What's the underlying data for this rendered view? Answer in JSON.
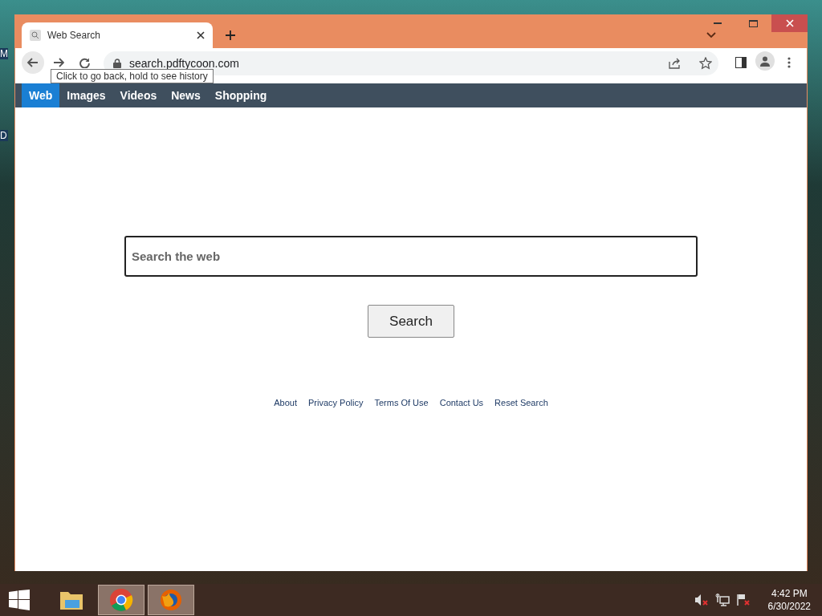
{
  "desktop": {
    "icon_labels": [
      "M",
      "D"
    ]
  },
  "browser": {
    "tab": {
      "title": "Web Search"
    },
    "address": "search.pdftycoon.com",
    "tooltip": "Click to go back, hold to see history"
  },
  "nav": [
    {
      "label": "Web",
      "selected": true
    },
    {
      "label": "Images",
      "selected": false
    },
    {
      "label": "Videos",
      "selected": false
    },
    {
      "label": "News",
      "selected": false
    },
    {
      "label": "Shopping",
      "selected": false
    }
  ],
  "search": {
    "placeholder": "Search the web",
    "button": "Search"
  },
  "footer_links": [
    "About",
    "Privacy Policy",
    "Terms Of Use",
    "Contact Us",
    "Reset Search"
  ],
  "taskbar": {
    "apps": [
      {
        "kind": "folder",
        "selected": false
      },
      {
        "kind": "chrome",
        "selected": true
      },
      {
        "kind": "firefox",
        "selected": true
      }
    ],
    "time": "4:42 PM",
    "date": "6/30/2022"
  }
}
